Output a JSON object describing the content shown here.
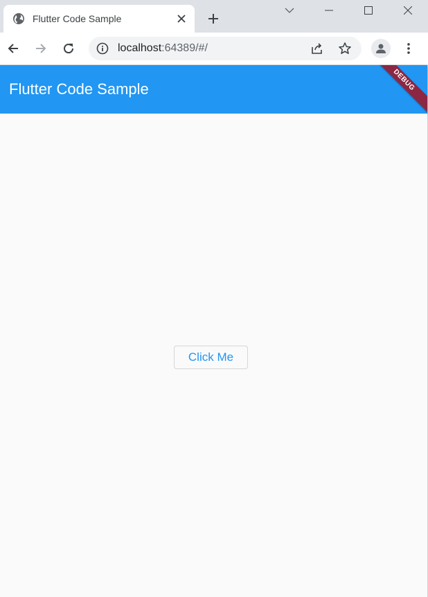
{
  "browser": {
    "tab": {
      "title": "Flutter Code Sample",
      "favicon_icon": "globe-icon",
      "close_icon": "close-icon"
    },
    "new_tab_icon": "plus-icon",
    "window_controls": [
      "chevron-down-icon",
      "minimize-icon",
      "maximize-icon",
      "close-icon"
    ],
    "toolbar": {
      "back_icon": "arrow-left-icon",
      "forward_icon": "arrow-right-icon",
      "reload_icon": "reload-icon",
      "url_host": "localhost",
      "url_rest": ":64389/#/",
      "site_info_icon": "info-icon",
      "share_icon": "share-icon",
      "bookmark_icon": "star-icon",
      "profile_icon": "person-icon",
      "menu_icon": "more-vertical-icon"
    }
  },
  "app": {
    "title": "Flutter Code Sample",
    "debug_banner": "DEBUG",
    "button_label": "Click Me",
    "colors": {
      "primary": "#2196f3",
      "banner": "#8b2743",
      "background": "#fafafa"
    }
  }
}
